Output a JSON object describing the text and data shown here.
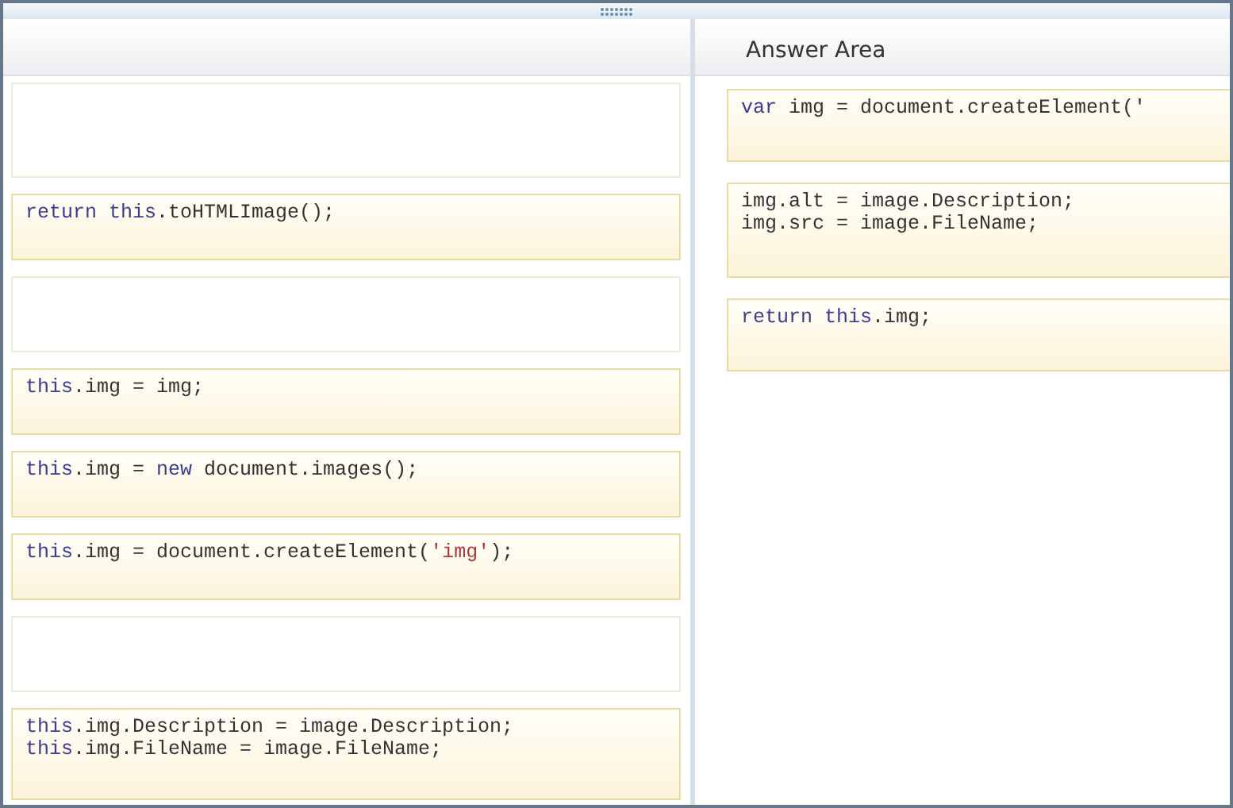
{
  "source_pane": {
    "slots": [
      {
        "kind": "empty"
      },
      {
        "kind": "code",
        "lines": [
          [
            {
              "text": "return this",
              "kind": "keyword"
            },
            {
              "text": ".toHTMLImage();",
              "kind": "plain"
            }
          ]
        ]
      },
      {
        "kind": "empty"
      },
      {
        "kind": "code",
        "lines": [
          [
            {
              "text": "this",
              "kind": "keyword"
            },
            {
              "text": ".img = img;",
              "kind": "plain"
            }
          ]
        ]
      },
      {
        "kind": "code",
        "lines": [
          [
            {
              "text": "this",
              "kind": "keyword"
            },
            {
              "text": ".img = ",
              "kind": "plain"
            },
            {
              "text": "new",
              "kind": "keyword"
            },
            {
              "text": " document.images();",
              "kind": "plain"
            }
          ]
        ]
      },
      {
        "kind": "code",
        "lines": [
          [
            {
              "text": "this",
              "kind": "keyword"
            },
            {
              "text": ".img = document.createElement(",
              "kind": "plain"
            },
            {
              "text": "'img'",
              "kind": "string"
            },
            {
              "text": ");",
              "kind": "plain"
            }
          ]
        ]
      },
      {
        "kind": "empty"
      },
      {
        "kind": "code",
        "lines": [
          [
            {
              "text": "this",
              "kind": "keyword"
            },
            {
              "text": ".img.Description = image.Description;",
              "kind": "plain"
            }
          ],
          [
            {
              "text": "this",
              "kind": "keyword"
            },
            {
              "text": ".img.FileName = image.FileName;",
              "kind": "plain"
            }
          ]
        ]
      }
    ]
  },
  "answer_area": {
    "title": "Answer Area",
    "slots": [
      {
        "kind": "code",
        "lines": [
          [
            {
              "text": "var",
              "kind": "keyword"
            },
            {
              "text": " img = document.createElement('",
              "kind": "plain"
            }
          ]
        ]
      },
      {
        "kind": "code",
        "lines": [
          [
            {
              "text": "img.alt = image.Description;",
              "kind": "plain"
            }
          ],
          [
            {
              "text": "img.src = image.FileName;",
              "kind": "plain"
            }
          ]
        ]
      },
      {
        "kind": "code",
        "lines": [
          [
            {
              "text": "return this",
              "kind": "keyword"
            },
            {
              "text": ".img;",
              "kind": "plain"
            }
          ]
        ]
      }
    ]
  }
}
